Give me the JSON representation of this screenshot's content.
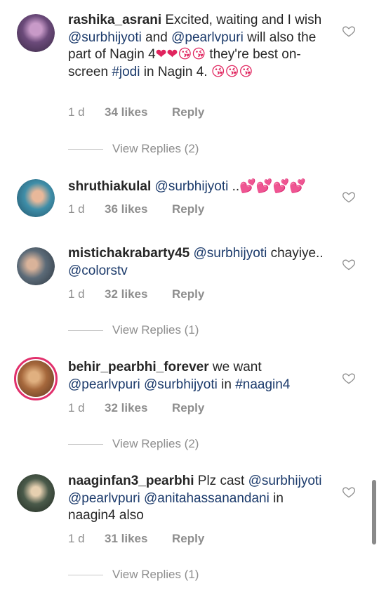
{
  "comments": [
    {
      "username": "rashika_asrani",
      "segments": [
        {
          "t": "Excited, waiting and I wish ",
          "k": "text"
        },
        {
          "t": "@surbhijyoti",
          "k": "mention"
        },
        {
          "t": "  and ",
          "k": "text"
        },
        {
          "t": "@pearlvpuri",
          "k": "mention"
        },
        {
          "t": " will also the part of Nagin 4",
          "k": "text"
        },
        {
          "t": "❤❤😘😘",
          "k": "emoji"
        },
        {
          "t": "  they're best on-screen ",
          "k": "text"
        },
        {
          "t": "#jodi",
          "k": "mention"
        },
        {
          "t": " in Nagin 4. ",
          "k": "text"
        },
        {
          "t": "😘😘😘",
          "k": "emoji"
        }
      ],
      "time": "1 d",
      "likes": "34 likes",
      "reply": "Reply",
      "view_replies": "View Replies (2)",
      "avatar_color": "#6b4a7a"
    },
    {
      "username": "shruthiakulal",
      "segments": [
        {
          "t": "@surbhijyoti",
          "k": "mention"
        },
        {
          "t": " ..",
          "k": "text"
        },
        {
          "t": "💕💕💕💕",
          "k": "emoji"
        }
      ],
      "time": "1 d",
      "likes": "36 likes",
      "reply": "Reply",
      "view_replies": "",
      "avatar_color": "#3f8ea8"
    },
    {
      "username": "mistichakrabarty45",
      "segments": [
        {
          "t": "@surbhijyoti",
          "k": "mention"
        },
        {
          "t": " chayiye.. ",
          "k": "text"
        },
        {
          "t": "@colorstv",
          "k": "mention"
        }
      ],
      "time": "1 d",
      "likes": "32 likes",
      "reply": "Reply",
      "view_replies": "View Replies (1)",
      "avatar_color": "#5c6b78"
    },
    {
      "username": "behir_pearbhi_forever",
      "segments": [
        {
          "t": "we want ",
          "k": "text"
        },
        {
          "t": "@pearlvpuri",
          "k": "mention"
        },
        {
          "t": " ",
          "k": "text"
        },
        {
          "t": "@surbhijyoti",
          "k": "mention"
        },
        {
          "t": " in ",
          "k": "text"
        },
        {
          "t": "#naagin4",
          "k": "mention"
        }
      ],
      "time": "1 d",
      "likes": "32 likes",
      "reply": "Reply",
      "view_replies": "View Replies (2)",
      "avatar_color": "#a6683c"
    },
    {
      "username": "naaginfan3_pearbhi",
      "segments": [
        {
          "t": "Plz cast ",
          "k": "text"
        },
        {
          "t": "@surbhijyoti",
          "k": "mention"
        },
        {
          "t": " ",
          "k": "text"
        },
        {
          "t": "@pearlvpuri",
          "k": "mention"
        },
        {
          "t": " ",
          "k": "text"
        },
        {
          "t": "@anitahassanandani",
          "k": "mention"
        },
        {
          "t": " in naagin4 also",
          "k": "text"
        }
      ],
      "time": "1 d",
      "likes": "31 likes",
      "reply": "Reply",
      "view_replies": "View Replies (1)",
      "avatar_color": "#4a5a4a"
    }
  ]
}
